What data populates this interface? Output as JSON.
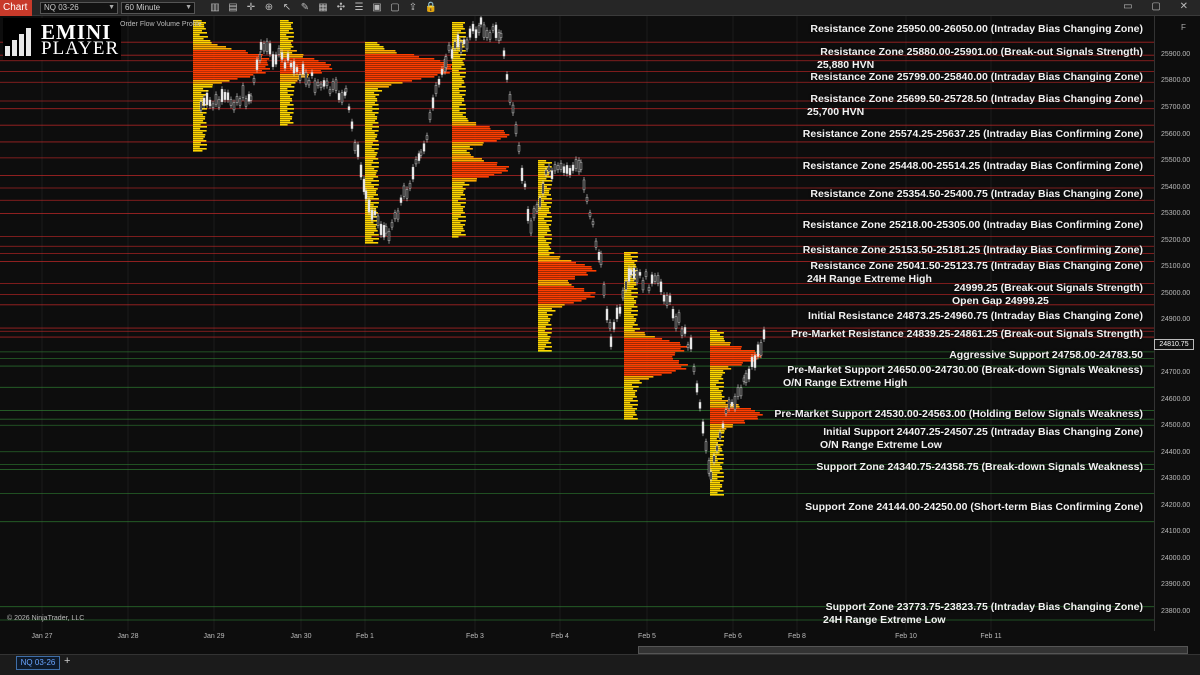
{
  "toolbar": {
    "chart_tab": "Chart",
    "instrument": "NQ 03-26",
    "interval": "60 Minute",
    "icons": [
      "bars-icon",
      "bar-chart-icon",
      "crosshair-icon",
      "zoom-in-icon",
      "zoom-out-icon",
      "pointer-icon",
      "pencil-icon",
      "chart-style-icon",
      "strategy-icon",
      "properties-icon",
      "data-box-icon",
      "template-icon",
      "share-icon",
      "lock-icon"
    ]
  },
  "logo": {
    "line1": "EMINI",
    "line2": "PLAYER"
  },
  "indicator_label": "Order Flow Volume Profile",
  "copyright": "© 2026 NinjaTrader, LLC",
  "last_price": "24810.75",
  "price_axis_button": "F",
  "bottom_tab": "NQ 03-26",
  "add_tab": "+",
  "zones": [
    {
      "text": "Resistance Zone 25950.00-26050.00 (Intraday Bias Changing Zone)",
      "color": "#c62828"
    },
    {
      "text": "Resistance Zone 25880.00-25901.00 (Break-out Signals Strength)",
      "color": "#c62828"
    },
    {
      "text": "25,880 HVN",
      "color": "#c62828"
    },
    {
      "text": "Resistance Zone 25799.00-25840.00 (Intraday Bias Changing Zone)",
      "color": "#c62828"
    },
    {
      "text": "Resistance Zone 25699.50-25728.50 (Intraday Bias Changing Zone)",
      "color": "#c62828"
    },
    {
      "text": "25,700 HVN",
      "color": "#c62828"
    },
    {
      "text": "Resistance Zone 25574.25-25637.25 (Intraday Bias Confirming Zone)",
      "color": "#c62828"
    },
    {
      "text": "Resistance Zone 25448.00-25514.25 (Intraday Bias Confirming Zone)",
      "color": "#c62828"
    },
    {
      "text": "Resistance Zone 25354.50-25400.75 (Intraday Bias Changing Zone)",
      "color": "#c62828"
    },
    {
      "text": "Resistance Zone 25218.00-25305.00 (Intraday Bias Confirming Zone)",
      "color": "#c62828"
    },
    {
      "text": "Resistance Zone 25153.50-25181.25 (Intraday Bias Confirming Zone)",
      "color": "#c62828"
    },
    {
      "text": "Resistance Zone 25041.50-25123.75 (Intraday Bias Changing Zone)",
      "color": "#c62828"
    },
    {
      "text": "24H Range Extreme High",
      "color": "#c62828"
    },
    {
      "text": "24999.25 (Break-out Signals Strength)",
      "color": "#c62828"
    },
    {
      "text": "Open Gap 24999.25",
      "color": "#c62828"
    },
    {
      "text": "Initial Resistance 24873.25-24960.75 (Intraday Bias Changing Zone)",
      "color": "#c62828"
    },
    {
      "text": "Pre-Market Resistance 24839.25-24861.25 (Break-out Signals Strength)",
      "color": "#c62828"
    },
    {
      "text": "Aggressive Support 24758.00-24783.50",
      "color": "#2e7d32"
    },
    {
      "text": "Pre-Market Support 24650.00-24730.00 (Break-down Signals Weakness)",
      "color": "#2e7d32"
    },
    {
      "text": "O/N Range Extreme High",
      "color": "#2e7d32"
    },
    {
      "text": "Pre-Market Support 24530.00-24563.00 (Holding Below Signals Weakness)",
      "color": "#2e7d32"
    },
    {
      "text": "Initial Support 24407.25-24507.25 (Intraday Bias Changing Zone)",
      "color": "#2e7d32"
    },
    {
      "text": "O/N Range Extreme Low",
      "color": "#2e7d32"
    },
    {
      "text": "Support Zone 24340.75-24358.75 (Break-down Signals Weakness)",
      "color": "#2e7d32"
    },
    {
      "text": "Support Zone 24144.00-24250.00 (Short-term Bias Confirming Zone)",
      "color": "#2e7d32"
    },
    {
      "text": "Support Zone 23773.75-23823.75 (Intraday Bias Changing Zone)",
      "color": "#2e7d32"
    },
    {
      "text": "24H Range Extreme Low",
      "color": "#2e7d32"
    }
  ],
  "price_ticks": [
    "25900.00",
    "25800.00",
    "25700.00",
    "25600.00",
    "25500.00",
    "25400.00",
    "25300.00",
    "25200.00",
    "25100.00",
    "25000.00",
    "24900.00",
    "24700.00",
    "24600.00",
    "24500.00",
    "24400.00",
    "24300.00",
    "24200.00",
    "24100.00",
    "24000.00",
    "23900.00",
    "23800.00"
  ],
  "time_ticks": [
    "Jan 27",
    "Jan 28",
    "Jan 29",
    "Jan 30",
    "Feb 1",
    "Feb 3",
    "Feb 4",
    "Feb 5",
    "Feb 6",
    "Feb 8",
    "Feb 10",
    "Feb 11"
  ],
  "colors": {
    "resistance": "#c62828",
    "support": "#2e7d32",
    "profile_hot": "#ff3d00",
    "profile_warm": "#ffab00",
    "profile_cool": "#ffd600"
  }
}
